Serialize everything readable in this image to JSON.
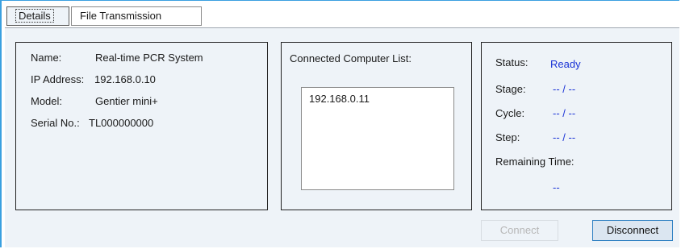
{
  "tabs": {
    "details": "Details",
    "file_transmission": "File Transmission"
  },
  "device_info": {
    "name_label": "Name:",
    "name_value": "Real-time PCR System",
    "ip_label": "IP Address:",
    "ip_value": "192.168.0.10",
    "model_label": "Model:",
    "model_value": "Gentier mini+",
    "serial_label": "Serial No.:",
    "serial_value": "TL000000000"
  },
  "connected": {
    "title": "Connected Computer List:",
    "items": [
      "192.168.0.11"
    ]
  },
  "status": {
    "status_label": "Status:",
    "status_value": "Ready",
    "stage_label": "Stage:",
    "stage_value": "-- / --",
    "cycle_label": "Cycle:",
    "cycle_value": "-- / --",
    "step_label": "Step:",
    "step_value": "-- / --",
    "remaining_label": "Remaining Time:",
    "remaining_value": "--",
    "value_color": "#1a33d6"
  },
  "buttons": {
    "connect": "Connect",
    "connect_enabled": false,
    "disconnect": "Disconnect"
  }
}
